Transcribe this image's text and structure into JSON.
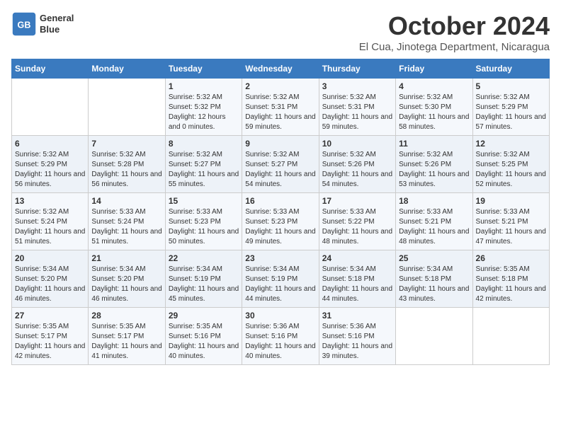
{
  "logo": {
    "line1": "General",
    "line2": "Blue"
  },
  "title": "October 2024",
  "subtitle": "El Cua, Jinotega Department, Nicaragua",
  "header": {
    "days": [
      "Sunday",
      "Monday",
      "Tuesday",
      "Wednesday",
      "Thursday",
      "Friday",
      "Saturday"
    ]
  },
  "weeks": [
    [
      {
        "day": "",
        "sunrise": "",
        "sunset": "",
        "daylight": ""
      },
      {
        "day": "",
        "sunrise": "",
        "sunset": "",
        "daylight": ""
      },
      {
        "day": "1",
        "sunrise": "Sunrise: 5:32 AM",
        "sunset": "Sunset: 5:32 PM",
        "daylight": "Daylight: 12 hours and 0 minutes."
      },
      {
        "day": "2",
        "sunrise": "Sunrise: 5:32 AM",
        "sunset": "Sunset: 5:31 PM",
        "daylight": "Daylight: 11 hours and 59 minutes."
      },
      {
        "day": "3",
        "sunrise": "Sunrise: 5:32 AM",
        "sunset": "Sunset: 5:31 PM",
        "daylight": "Daylight: 11 hours and 59 minutes."
      },
      {
        "day": "4",
        "sunrise": "Sunrise: 5:32 AM",
        "sunset": "Sunset: 5:30 PM",
        "daylight": "Daylight: 11 hours and 58 minutes."
      },
      {
        "day": "5",
        "sunrise": "Sunrise: 5:32 AM",
        "sunset": "Sunset: 5:29 PM",
        "daylight": "Daylight: 11 hours and 57 minutes."
      }
    ],
    [
      {
        "day": "6",
        "sunrise": "Sunrise: 5:32 AM",
        "sunset": "Sunset: 5:29 PM",
        "daylight": "Daylight: 11 hours and 56 minutes."
      },
      {
        "day": "7",
        "sunrise": "Sunrise: 5:32 AM",
        "sunset": "Sunset: 5:28 PM",
        "daylight": "Daylight: 11 hours and 56 minutes."
      },
      {
        "day": "8",
        "sunrise": "Sunrise: 5:32 AM",
        "sunset": "Sunset: 5:27 PM",
        "daylight": "Daylight: 11 hours and 55 minutes."
      },
      {
        "day": "9",
        "sunrise": "Sunrise: 5:32 AM",
        "sunset": "Sunset: 5:27 PM",
        "daylight": "Daylight: 11 hours and 54 minutes."
      },
      {
        "day": "10",
        "sunrise": "Sunrise: 5:32 AM",
        "sunset": "Sunset: 5:26 PM",
        "daylight": "Daylight: 11 hours and 54 minutes."
      },
      {
        "day": "11",
        "sunrise": "Sunrise: 5:32 AM",
        "sunset": "Sunset: 5:26 PM",
        "daylight": "Daylight: 11 hours and 53 minutes."
      },
      {
        "day": "12",
        "sunrise": "Sunrise: 5:32 AM",
        "sunset": "Sunset: 5:25 PM",
        "daylight": "Daylight: 11 hours and 52 minutes."
      }
    ],
    [
      {
        "day": "13",
        "sunrise": "Sunrise: 5:32 AM",
        "sunset": "Sunset: 5:24 PM",
        "daylight": "Daylight: 11 hours and 51 minutes."
      },
      {
        "day": "14",
        "sunrise": "Sunrise: 5:33 AM",
        "sunset": "Sunset: 5:24 PM",
        "daylight": "Daylight: 11 hours and 51 minutes."
      },
      {
        "day": "15",
        "sunrise": "Sunrise: 5:33 AM",
        "sunset": "Sunset: 5:23 PM",
        "daylight": "Daylight: 11 hours and 50 minutes."
      },
      {
        "day": "16",
        "sunrise": "Sunrise: 5:33 AM",
        "sunset": "Sunset: 5:23 PM",
        "daylight": "Daylight: 11 hours and 49 minutes."
      },
      {
        "day": "17",
        "sunrise": "Sunrise: 5:33 AM",
        "sunset": "Sunset: 5:22 PM",
        "daylight": "Daylight: 11 hours and 48 minutes."
      },
      {
        "day": "18",
        "sunrise": "Sunrise: 5:33 AM",
        "sunset": "Sunset: 5:21 PM",
        "daylight": "Daylight: 11 hours and 48 minutes."
      },
      {
        "day": "19",
        "sunrise": "Sunrise: 5:33 AM",
        "sunset": "Sunset: 5:21 PM",
        "daylight": "Daylight: 11 hours and 47 minutes."
      }
    ],
    [
      {
        "day": "20",
        "sunrise": "Sunrise: 5:34 AM",
        "sunset": "Sunset: 5:20 PM",
        "daylight": "Daylight: 11 hours and 46 minutes."
      },
      {
        "day": "21",
        "sunrise": "Sunrise: 5:34 AM",
        "sunset": "Sunset: 5:20 PM",
        "daylight": "Daylight: 11 hours and 46 minutes."
      },
      {
        "day": "22",
        "sunrise": "Sunrise: 5:34 AM",
        "sunset": "Sunset: 5:19 PM",
        "daylight": "Daylight: 11 hours and 45 minutes."
      },
      {
        "day": "23",
        "sunrise": "Sunrise: 5:34 AM",
        "sunset": "Sunset: 5:19 PM",
        "daylight": "Daylight: 11 hours and 44 minutes."
      },
      {
        "day": "24",
        "sunrise": "Sunrise: 5:34 AM",
        "sunset": "Sunset: 5:18 PM",
        "daylight": "Daylight: 11 hours and 44 minutes."
      },
      {
        "day": "25",
        "sunrise": "Sunrise: 5:34 AM",
        "sunset": "Sunset: 5:18 PM",
        "daylight": "Daylight: 11 hours and 43 minutes."
      },
      {
        "day": "26",
        "sunrise": "Sunrise: 5:35 AM",
        "sunset": "Sunset: 5:18 PM",
        "daylight": "Daylight: 11 hours and 42 minutes."
      }
    ],
    [
      {
        "day": "27",
        "sunrise": "Sunrise: 5:35 AM",
        "sunset": "Sunset: 5:17 PM",
        "daylight": "Daylight: 11 hours and 42 minutes."
      },
      {
        "day": "28",
        "sunrise": "Sunrise: 5:35 AM",
        "sunset": "Sunset: 5:17 PM",
        "daylight": "Daylight: 11 hours and 41 minutes."
      },
      {
        "day": "29",
        "sunrise": "Sunrise: 5:35 AM",
        "sunset": "Sunset: 5:16 PM",
        "daylight": "Daylight: 11 hours and 40 minutes."
      },
      {
        "day": "30",
        "sunrise": "Sunrise: 5:36 AM",
        "sunset": "Sunset: 5:16 PM",
        "daylight": "Daylight: 11 hours and 40 minutes."
      },
      {
        "day": "31",
        "sunrise": "Sunrise: 5:36 AM",
        "sunset": "Sunset: 5:16 PM",
        "daylight": "Daylight: 11 hours and 39 minutes."
      },
      {
        "day": "",
        "sunrise": "",
        "sunset": "",
        "daylight": ""
      },
      {
        "day": "",
        "sunrise": "",
        "sunset": "",
        "daylight": ""
      }
    ]
  ]
}
